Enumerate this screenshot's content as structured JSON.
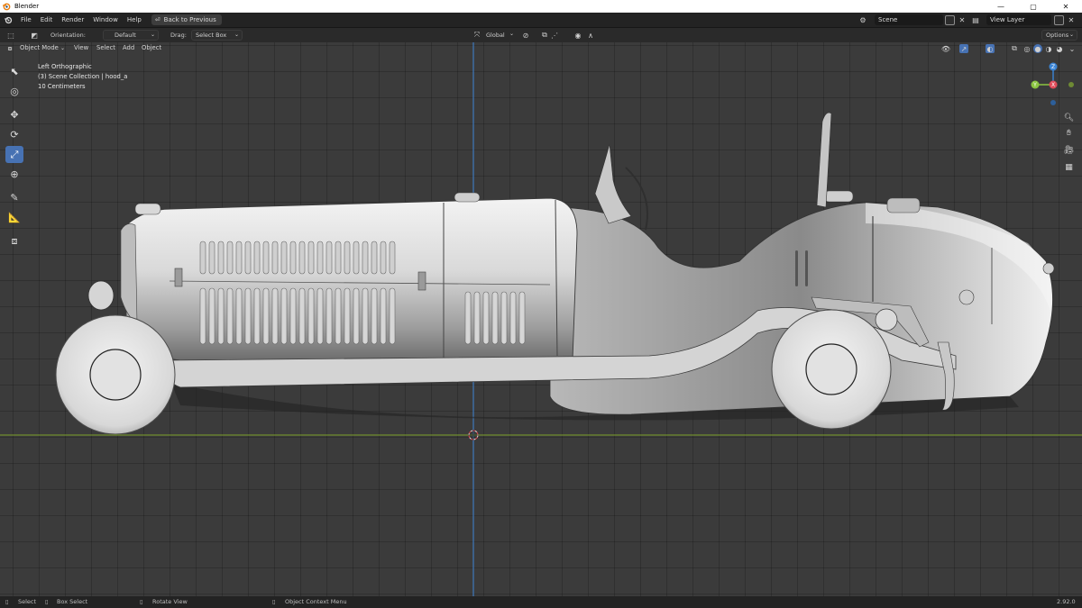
{
  "window": {
    "title": "Blender",
    "minimize": "—",
    "maximize": "▢",
    "close": "✕"
  },
  "menubar": {
    "items": [
      "File",
      "Edit",
      "Render",
      "Window",
      "Help"
    ],
    "back_button": "Back to Previous",
    "scene_value": "Scene",
    "view_layer_value": "View Layer"
  },
  "toolheader": {
    "orientation_label": "Orientation:",
    "orientation_value": "Default",
    "drag_label": "Drag:",
    "drag_value": "Select Box",
    "transform_orientation": "Global",
    "options_label": "Options"
  },
  "viewheader": {
    "mode": "Object Mode",
    "menus": [
      "View",
      "Select",
      "Add",
      "Object"
    ]
  },
  "overlay": {
    "view_name": "Left Orthographic",
    "collection": "(3) Scene Collection | hood_a",
    "scale": "10 Centimeters"
  },
  "gizmo": {
    "z": "Z",
    "y": "Y",
    "x": "X"
  },
  "statusbar": {
    "select": "Select",
    "box_select": "Box Select",
    "rotate_view": "Rotate View",
    "context_menu": "Object Context Menu",
    "version": "2.92.0"
  },
  "colors": {
    "accent": "#4772b3",
    "axis_x": "#e04c5a",
    "axis_y": "#8bc441",
    "axis_z": "#3b85d6",
    "grid_bg": "#3b3b3b"
  }
}
